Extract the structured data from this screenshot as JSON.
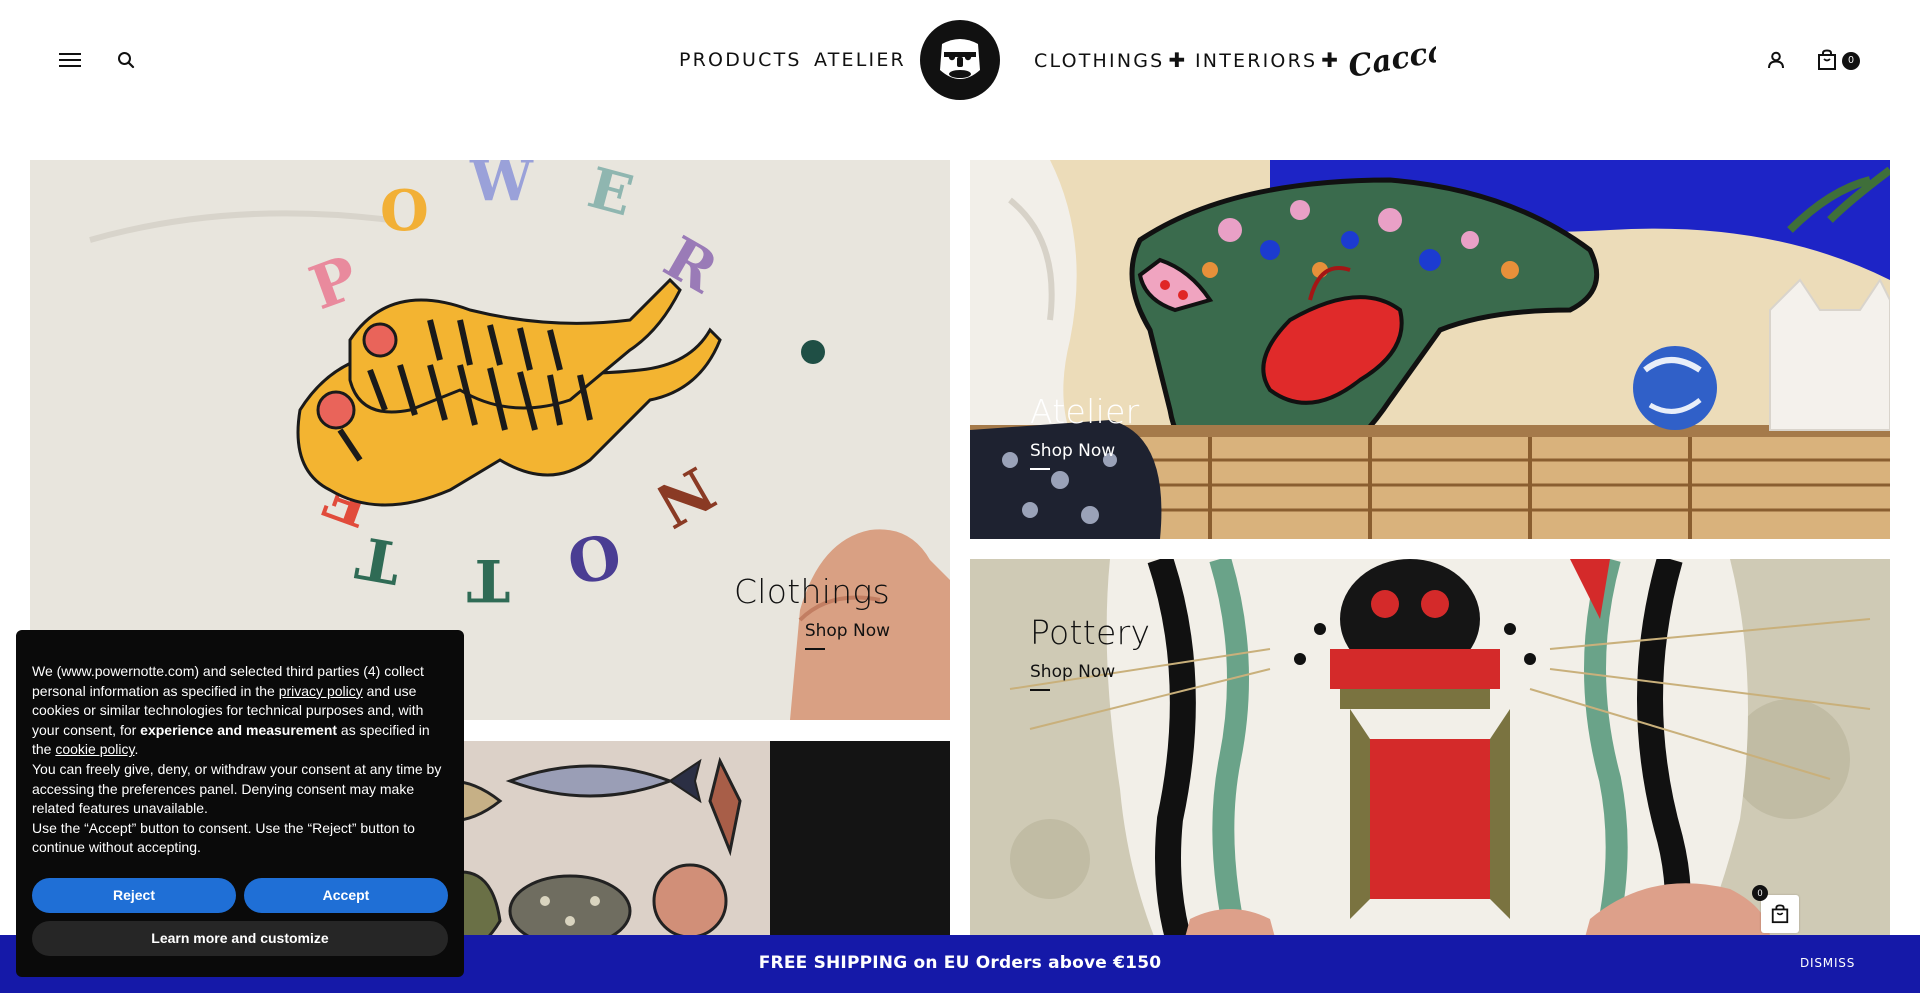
{
  "header": {
    "nav": {
      "products": "PRODUCTS",
      "atelier": "ATELIER",
      "clothings": "CLOTHINGS",
      "interiors": "INTERIORS",
      "plus": "✚"
    },
    "script_logo_text": "Cacca",
    "cart_count": "0",
    "icons": [
      "menu-icon",
      "search-icon",
      "brand-face-logo",
      "user-icon",
      "bag-icon"
    ]
  },
  "tiles": {
    "clothings": {
      "title": "Clothings",
      "cta": "Shop Now"
    },
    "atelier": {
      "title": "Atelier",
      "cta": "Shop Now"
    },
    "pottery": {
      "title": "Pottery",
      "cta": "Shop Now"
    }
  },
  "cookie": {
    "p1_a": "We (www.powernotte.com) and selected third parties (4) collect personal information as specified in the ",
    "privacy_link": "privacy policy",
    "p1_b": " and use cookies or similar technologies for technical purposes and, with your consent, for ",
    "p1_bold": "experience and measurement",
    "p1_c": " as specified in the ",
    "cookie_link": "cookie policy",
    "p1_d": ".",
    "p2": "You can freely give, deny, or withdraw your consent at any time by accessing the preferences panel. Denying consent may make related features unavailable.",
    "p3": "Use the “Accept” button to consent. Use the “Reject” button to continue without accepting.",
    "reject": "Reject",
    "accept": "Accept",
    "customize": "Learn more and customize"
  },
  "shipping_bar": {
    "text": "FREE SHIPPING on EU Orders above €150",
    "dismiss": "DISMISS"
  },
  "floating_cart": {
    "count": "0"
  },
  "colors": {
    "shipping_bar": "#1519a8",
    "cookie_bg": "#0a0a0a",
    "cookie_button": "#1f6fd6",
    "text": "#111111"
  }
}
